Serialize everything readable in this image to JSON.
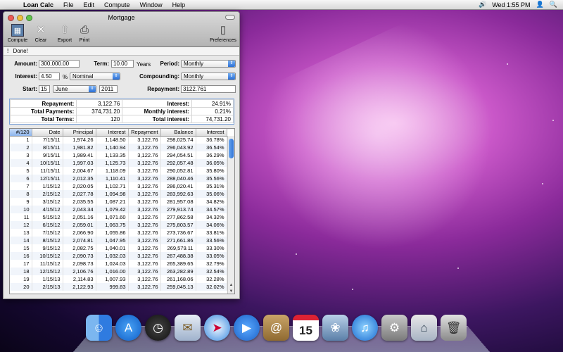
{
  "menubar": {
    "app": "Loan Calc",
    "items": [
      "File",
      "Edit",
      "Compute",
      "Window",
      "Help"
    ],
    "clock": "Wed 1:55 PM"
  },
  "window": {
    "title": "Mortgage",
    "toolbar": {
      "compute": "Compute",
      "clear": "Clear",
      "export": "Export",
      "print": "Print",
      "preferences": "Preferences"
    },
    "status": "Done!"
  },
  "form": {
    "amount_label": "Amount:",
    "amount": "300,000.00",
    "term_label": "Term:",
    "term": "10.00",
    "term_unit": "Years",
    "period_label": "Period:",
    "period": "Monthly",
    "interest_label": "Interest:",
    "interest": "4.50",
    "interest_unit": "%",
    "interest_type": "Nominal",
    "compounding_label": "Compounding:",
    "compounding": "Monthly",
    "start_label": "Start:",
    "start_day": "15",
    "start_month": "June",
    "start_year": "2011",
    "repayment_label": "Repayment:",
    "repayment": "3122.761"
  },
  "summary": [
    [
      "Repayment:",
      "3,122.76",
      "Interest:",
      "24.91%"
    ],
    [
      "Total Payments:",
      "374,731.20",
      "Monthly interest:",
      "0.21%"
    ],
    [
      "Total Terms:",
      "120",
      "Total interest:",
      "74,731.20"
    ]
  ],
  "table": {
    "headers": [
      "#/120",
      "Date",
      "Principal",
      "Interest",
      "Repayment",
      "Balance",
      "Interest"
    ],
    "rows": [
      [
        "1",
        "7/15/11",
        "1,974.26",
        "1,148.50",
        "3,122.76",
        "298,025.74",
        "36.78%"
      ],
      [
        "2",
        "8/15/11",
        "1,981.82",
        "1,140.94",
        "3,122.76",
        "296,043.92",
        "36.54%"
      ],
      [
        "3",
        "9/15/11",
        "1,989.41",
        "1,133.35",
        "3,122.76",
        "294,054.51",
        "36.29%"
      ],
      [
        "4",
        "10/15/11",
        "1,997.03",
        "1,125.73",
        "3,122.76",
        "292,057.48",
        "36.05%"
      ],
      [
        "5",
        "11/15/11",
        "2,004.67",
        "1,118.09",
        "3,122.76",
        "290,052.81",
        "35.80%"
      ],
      [
        "6",
        "12/15/11",
        "2,012.35",
        "1,110.41",
        "3,122.76",
        "288,040.46",
        "35.56%"
      ],
      [
        "7",
        "1/15/12",
        "2,020.05",
        "1,102.71",
        "3,122.76",
        "286,020.41",
        "35.31%"
      ],
      [
        "8",
        "2/15/12",
        "2,027.78",
        "1,094.98",
        "3,122.76",
        "283,992.63",
        "35.06%"
      ],
      [
        "9",
        "3/15/12",
        "2,035.55",
        "1,087.21",
        "3,122.76",
        "281,957.08",
        "34.82%"
      ],
      [
        "10",
        "4/15/12",
        "2,043.34",
        "1,079.42",
        "3,122.76",
        "279,913.74",
        "34.57%"
      ],
      [
        "11",
        "5/15/12",
        "2,051.16",
        "1,071.60",
        "3,122.76",
        "277,862.58",
        "34.32%"
      ],
      [
        "12",
        "6/15/12",
        "2,059.01",
        "1,063.75",
        "3,122.76",
        "275,803.57",
        "34.06%"
      ],
      [
        "13",
        "7/15/12",
        "2,066.90",
        "1,055.86",
        "3,122.76",
        "273,736.67",
        "33.81%"
      ],
      [
        "14",
        "8/15/12",
        "2,074.81",
        "1,047.95",
        "3,122.76",
        "271,661.86",
        "33.56%"
      ],
      [
        "15",
        "9/15/12",
        "2,082.75",
        "1,040.01",
        "3,122.76",
        "269,579.11",
        "33.30%"
      ],
      [
        "16",
        "10/15/12",
        "2,090.73",
        "1,032.03",
        "3,122.76",
        "267,488.38",
        "33.05%"
      ],
      [
        "17",
        "11/15/12",
        "2,098.73",
        "1,024.03",
        "3,122.76",
        "265,389.65",
        "32.79%"
      ],
      [
        "18",
        "12/15/12",
        "2,106.76",
        "1,016.00",
        "3,122.76",
        "263,282.89",
        "32.54%"
      ],
      [
        "19",
        "1/15/13",
        "2,114.83",
        "1,007.93",
        "3,122.76",
        "261,168.06",
        "32.28%"
      ],
      [
        "20",
        "2/15/13",
        "2,122.93",
        "999.83",
        "3,122.76",
        "259,045.13",
        "32.02%"
      ]
    ]
  },
  "dock": {
    "icons": [
      "finder-icon",
      "app-store-icon",
      "dashboard-icon",
      "mail-icon",
      "safari-icon",
      "facetime-icon",
      "address-book-icon",
      "ical-icon",
      "iphoto-icon",
      "itunes-icon",
      "system-preferences-icon",
      "loan-calc-icon",
      "trash-icon"
    ],
    "calendar_day": "15"
  },
  "colors": {
    "selection": "#3a75d6",
    "accent": "#2b6fd6"
  }
}
